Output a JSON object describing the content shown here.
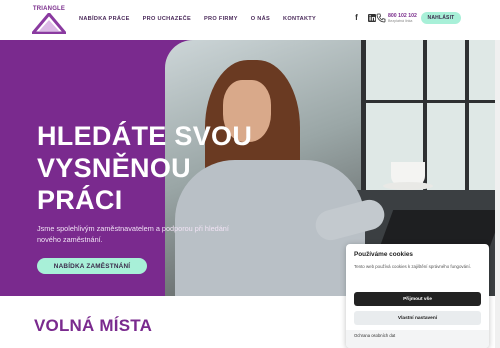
{
  "header": {
    "logo_text": "TRIANGLE",
    "nav": [
      "NABÍDKA PRÁCE",
      "PRO UCHAZEČE",
      "PRO FIRMY",
      "O NÁS",
      "KONTAKTY"
    ],
    "socials": [
      "facebook-icon",
      "linkedin-icon"
    ],
    "phone": "800 102 102",
    "phone_sub": "Bezplatná linka",
    "login_label": "NAHLÁSIT"
  },
  "hero": {
    "title": "HLEDÁTE SVOU VYSNĚNOU PRÁCI",
    "subtitle": "Jsme spolehlivým zaměstnavatelem a podporou při hledání nového zaměstnání.",
    "button_label": "NABÍDKA ZAMĚSTNÁNÍ"
  },
  "section": {
    "title": "VOLNÁ MÍSTA"
  },
  "cookies": {
    "title": "Používáme cookies",
    "text": "Tento web používá cookies k zajištění správného fungování.",
    "accept_label": "Přijmout vše",
    "settings_label": "Vlastní nastavení",
    "privacy_link": "Ochrana osobních dat"
  },
  "colors": {
    "brand_purple": "#7a2a8e",
    "accent_mint": "#a8f0d8"
  }
}
